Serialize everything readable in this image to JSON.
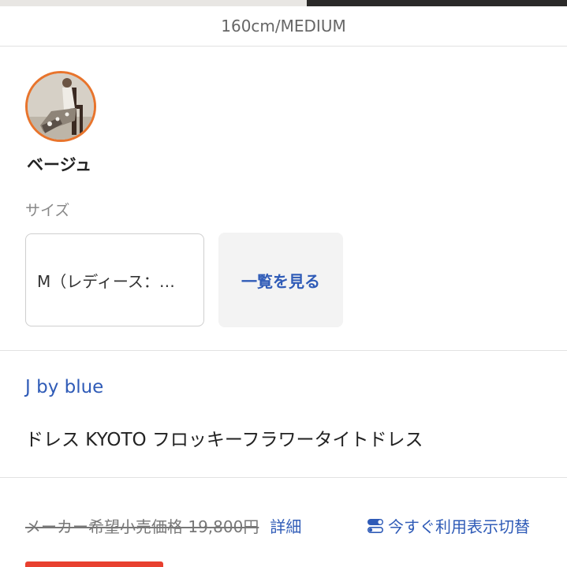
{
  "model_caption": "160cm/MEDIUM",
  "color": {
    "name": "ベージュ",
    "swatch_accent": "#e8742c"
  },
  "size": {
    "label": "サイズ",
    "selected": "M（レディース：…",
    "list_button": "一覧を見る"
  },
  "product": {
    "brand": "J by blue",
    "name": "ドレス KYOTO フロッキーフラワータイトドレス"
  },
  "price": {
    "msrp_text": "メーカー希望小売価格 19,800円",
    "detail_link": "詳細",
    "toggle_label": "今すぐ利用表示切替",
    "toggle_icon": "toggle-switch-icon"
  },
  "colors": {
    "link": "#2f5bb7",
    "sale_badge": "#e8402f"
  }
}
